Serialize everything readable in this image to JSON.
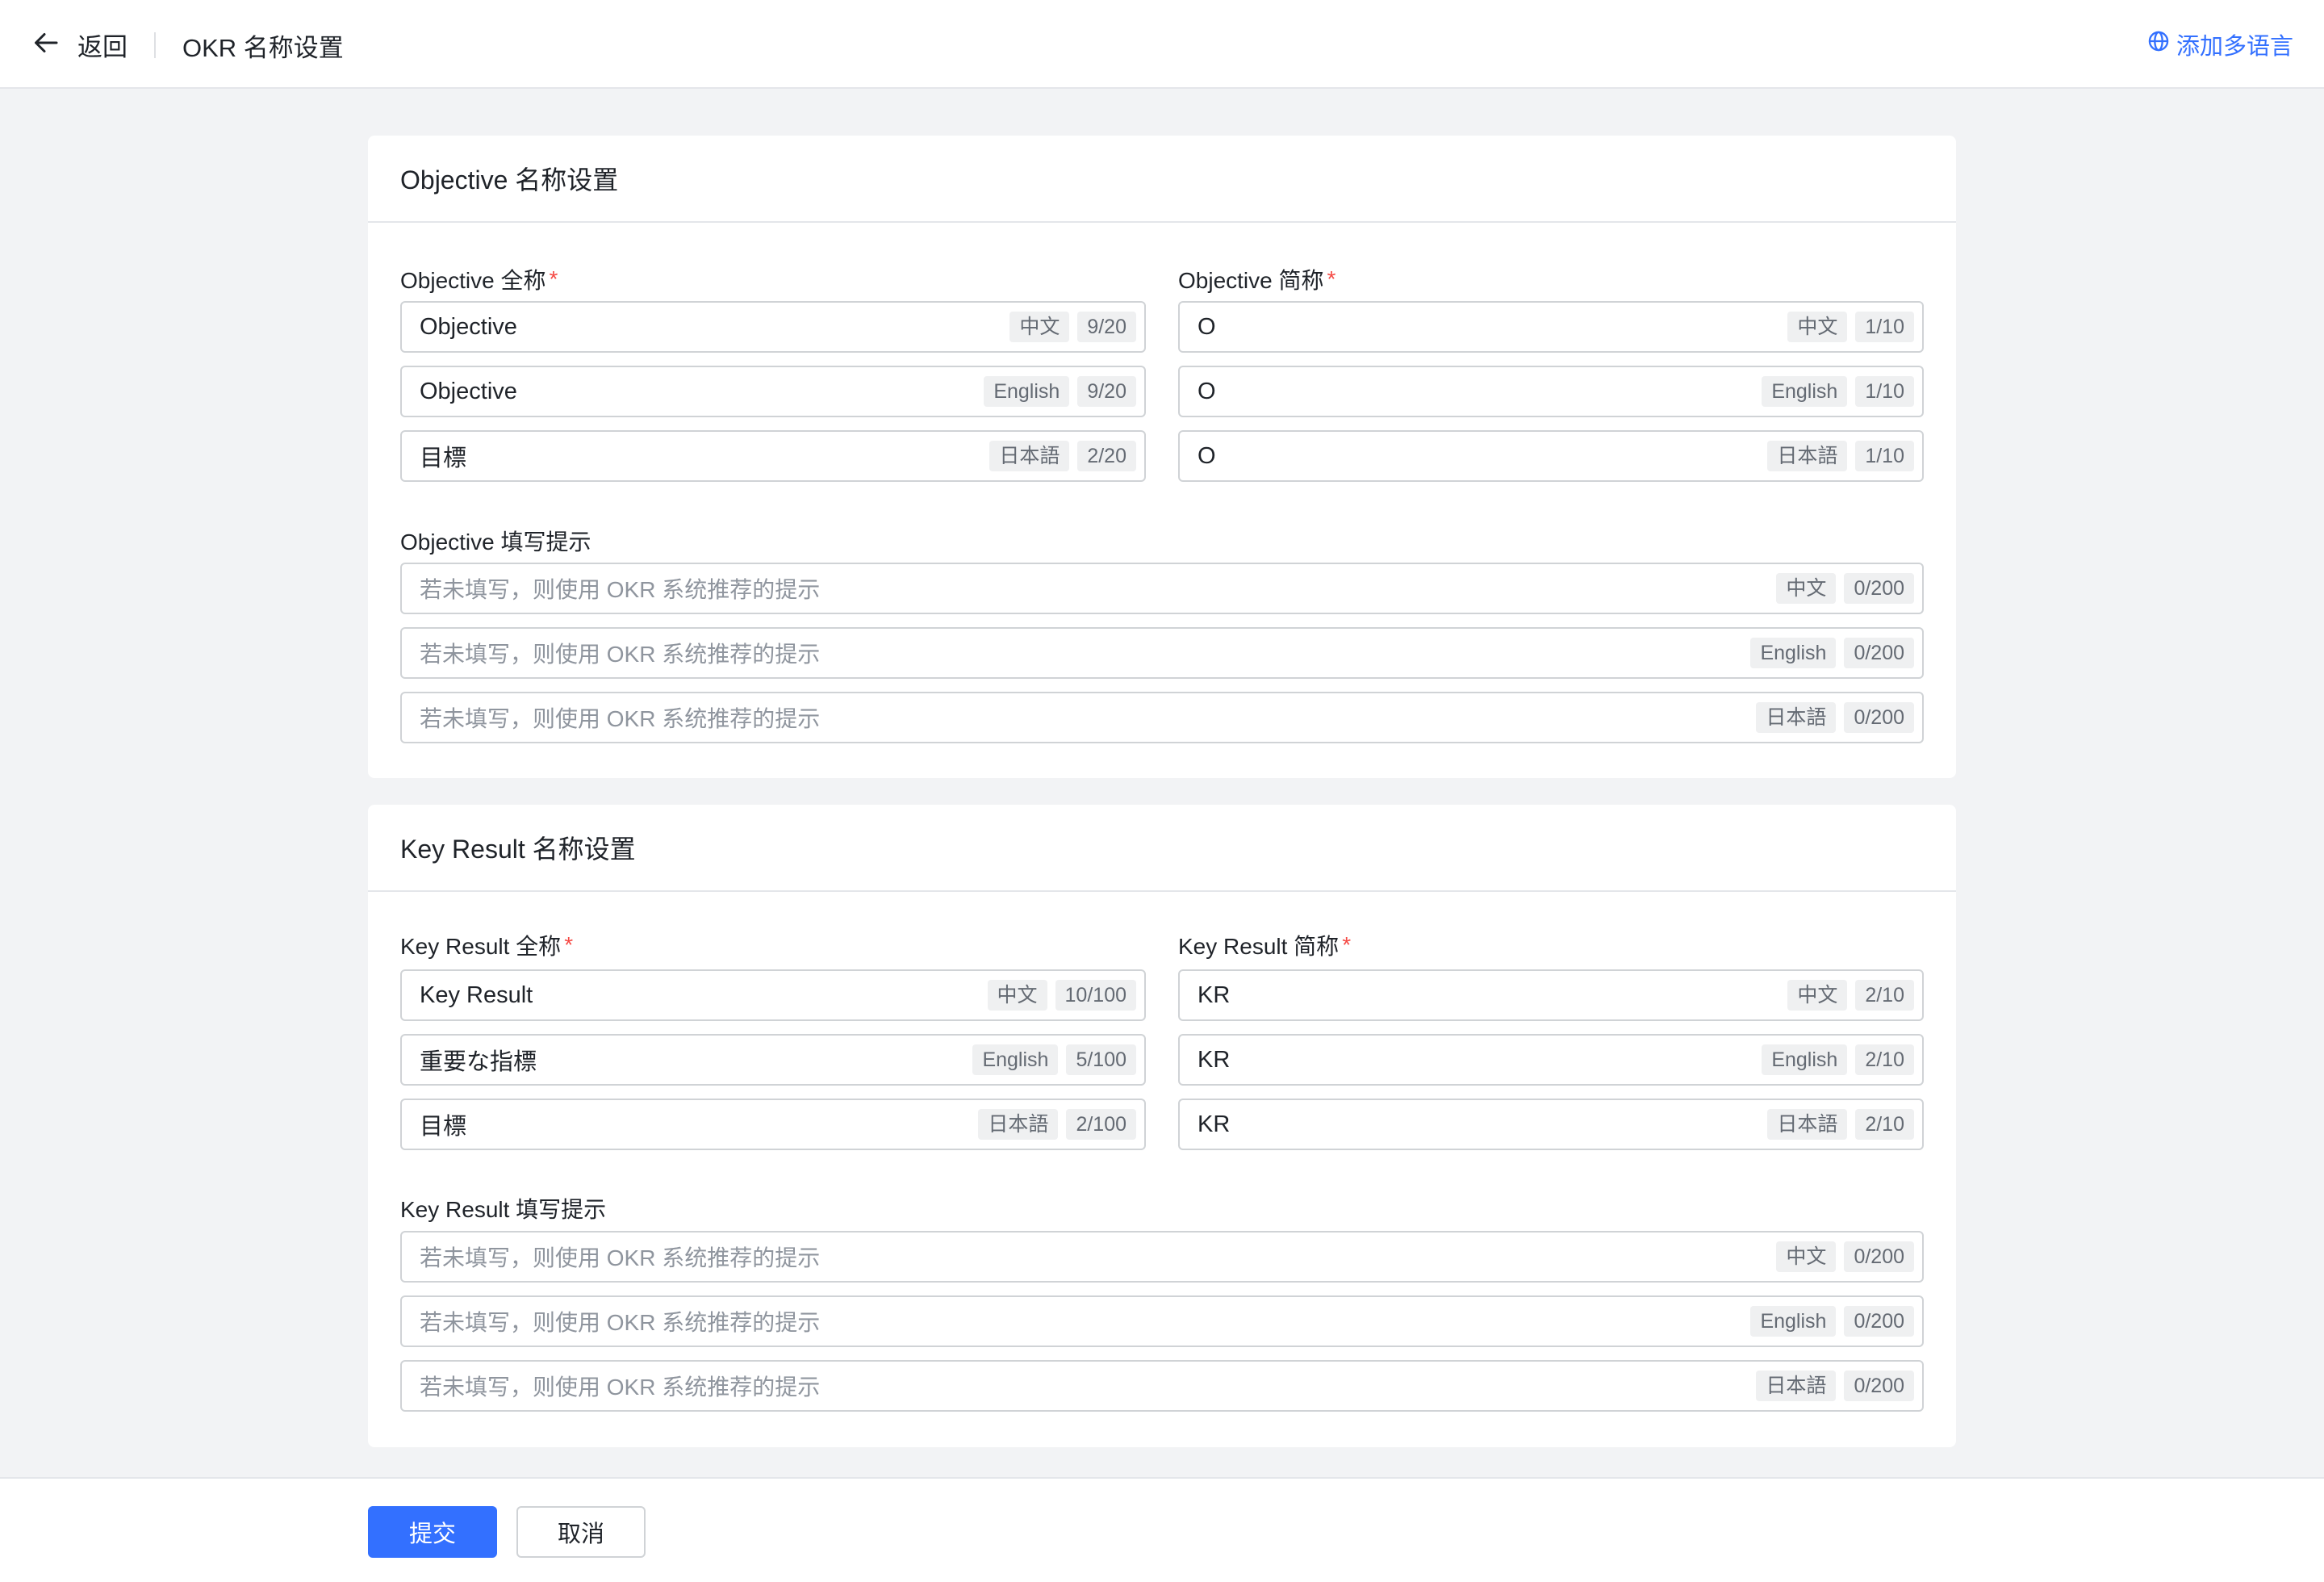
{
  "header": {
    "back_label": "返回",
    "title": "OKR 名称设置",
    "add_language": "添加多语言"
  },
  "objective": {
    "section_title": "Objective 名称设置",
    "full_name_label": "Objective 全称",
    "short_name_label": "Objective 简称",
    "hint_label": "Objective 填写提示",
    "full_name": [
      {
        "value": "Objective",
        "lang": "中文",
        "count": "9/20"
      },
      {
        "value": "Objective",
        "lang": "English",
        "count": "9/20"
      },
      {
        "value": "目標",
        "lang": "日本語",
        "count": "2/20"
      }
    ],
    "short_name": [
      {
        "value": "O",
        "lang": "中文",
        "count": "1/10"
      },
      {
        "value": "O",
        "lang": "English",
        "count": "1/10"
      },
      {
        "value": "O",
        "lang": "日本語",
        "count": "1/10"
      }
    ],
    "hint": [
      {
        "placeholder": "若未填写，则使用 OKR 系统推荐的提示",
        "lang": "中文",
        "count": "0/200"
      },
      {
        "placeholder": "若未填写，则使用 OKR 系统推荐的提示",
        "lang": "English",
        "count": "0/200"
      },
      {
        "placeholder": "若未填写，则使用 OKR 系统推荐的提示",
        "lang": "日本語",
        "count": "0/200"
      }
    ]
  },
  "key_result": {
    "section_title": "Key Result 名称设置",
    "full_name_label": "Key Result 全称",
    "short_name_label": "Key Result 简称",
    "hint_label": "Key Result 填写提示",
    "full_name": [
      {
        "value": "Key Result",
        "lang": "中文",
        "count": "10/100"
      },
      {
        "value": "重要な指標",
        "lang": "English",
        "count": "5/100"
      },
      {
        "value": "目標",
        "lang": "日本語",
        "count": "2/100"
      }
    ],
    "short_name": [
      {
        "value": "KR",
        "lang": "中文",
        "count": "2/10"
      },
      {
        "value": "KR",
        "lang": "English",
        "count": "2/10"
      },
      {
        "value": "KR",
        "lang": "日本語",
        "count": "2/10"
      }
    ],
    "hint": [
      {
        "placeholder": "若未填写，则使用 OKR 系统推荐的提示",
        "lang": "中文",
        "count": "0/200"
      },
      {
        "placeholder": "若未填写，则使用 OKR 系统推荐的提示",
        "lang": "English",
        "count": "0/200"
      },
      {
        "placeholder": "若未填写，则使用 OKR 系统推荐的提示",
        "lang": "日本語",
        "count": "0/200"
      }
    ]
  },
  "required_mark": "*",
  "footer": {
    "submit_label": "提交",
    "cancel_label": "取消"
  },
  "colors": {
    "accent": "#3370ff",
    "required": "#f54a45",
    "background": "#f2f3f5"
  }
}
